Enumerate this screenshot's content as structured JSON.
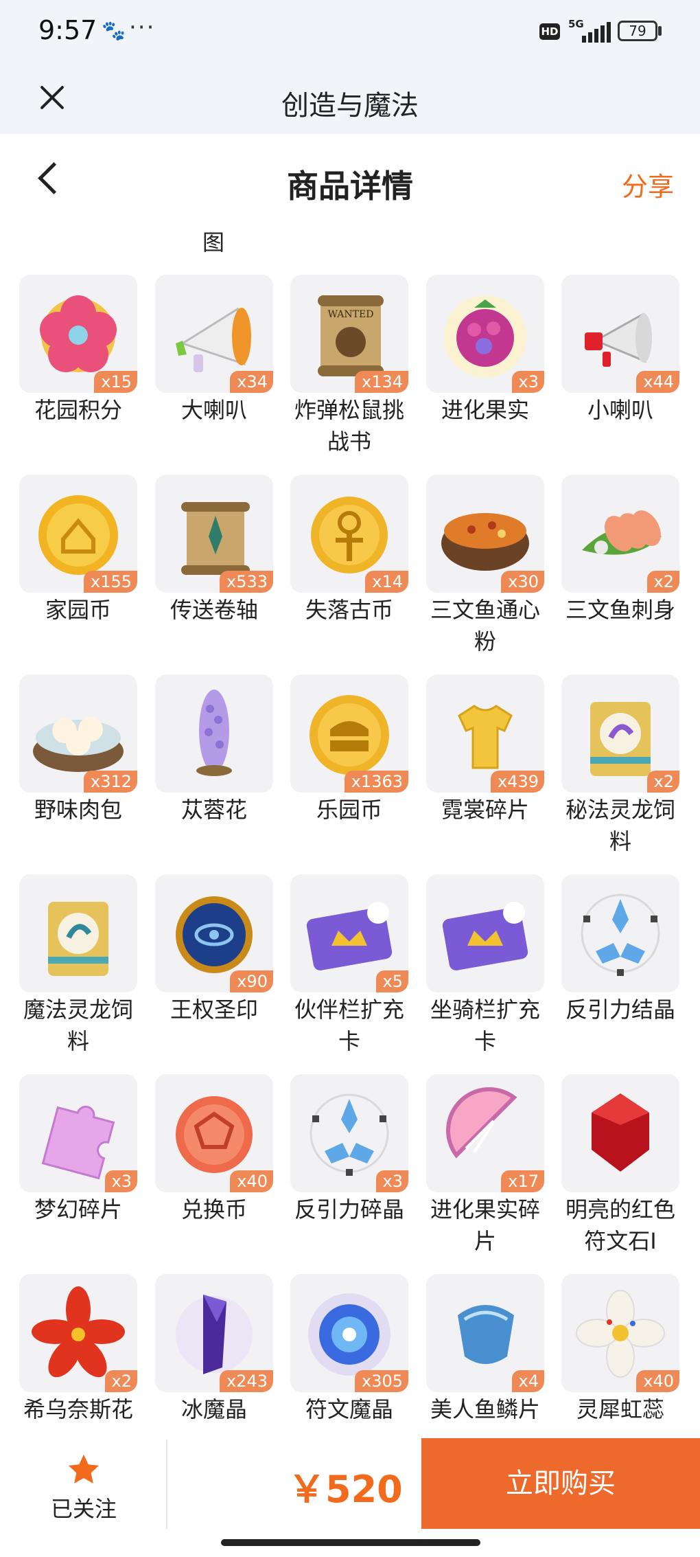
{
  "status": {
    "time": "9:57",
    "network": "5G",
    "hd": "HD",
    "battery": "79"
  },
  "window": {
    "title": "创造与魔法"
  },
  "nav": {
    "title": "商品详情",
    "share": "分享"
  },
  "section_caption": "图",
  "items": [
    {
      "name": "花园积分",
      "qty": "x15",
      "icon": "flower-token-icon"
    },
    {
      "name": "大喇叭",
      "qty": "x34",
      "icon": "megaphone-icon"
    },
    {
      "name": "炸弹松鼠挑战书",
      "qty": "x134",
      "icon": "wanted-scroll-icon"
    },
    {
      "name": "进化果实",
      "qty": "x3",
      "icon": "berry-icon"
    },
    {
      "name": "小喇叭",
      "qty": "x44",
      "icon": "small-megaphone-icon"
    },
    {
      "name": "家园币",
      "qty": "x155",
      "icon": "home-coin-icon"
    },
    {
      "name": "传送卷轴",
      "qty": "x533",
      "icon": "teleport-scroll-icon"
    },
    {
      "name": "失落古币",
      "qty": "x14",
      "icon": "ancient-coin-icon"
    },
    {
      "name": "三文鱼通心粉",
      "qty": "x30",
      "icon": "salmon-pasta-icon"
    },
    {
      "name": "三文鱼刺身",
      "qty": "x2",
      "icon": "salmon-sashimi-icon"
    },
    {
      "name": "野味肉包",
      "qty": "x312",
      "icon": "bun-steamer-icon"
    },
    {
      "name": "苁蓉花",
      "qty": "",
      "icon": "cistanche-flower-icon"
    },
    {
      "name": "乐园币",
      "qty": "x1363",
      "icon": "paradise-coin-icon"
    },
    {
      "name": "霓裳碎片",
      "qty": "x439",
      "icon": "shirt-fragment-icon"
    },
    {
      "name": "秘法灵龙饲料",
      "qty": "x2",
      "icon": "dragon-feed-bag-icon"
    },
    {
      "name": "魔法灵龙饲料",
      "qty": "",
      "icon": "magic-dragon-feed-icon"
    },
    {
      "name": "王权圣印",
      "qty": "x90",
      "icon": "royal-seal-icon"
    },
    {
      "name": "伙伴栏扩充卡",
      "qty": "x5",
      "icon": "partner-slot-card-icon"
    },
    {
      "name": "坐骑栏扩充卡",
      "qty": "",
      "icon": "mount-slot-card-icon"
    },
    {
      "name": "反引力结晶",
      "qty": "",
      "icon": "antigravity-crystal-icon"
    },
    {
      "name": "梦幻碎片",
      "qty": "x3",
      "icon": "puzzle-piece-icon"
    },
    {
      "name": "兑换币",
      "qty": "x40",
      "icon": "exchange-coin-icon"
    },
    {
      "name": "反引力碎晶",
      "qty": "x3",
      "icon": "antigravity-shard-icon"
    },
    {
      "name": "进化果实碎片",
      "qty": "x17",
      "icon": "fruit-slice-icon"
    },
    {
      "name": "明亮的红色符文石I",
      "qty": "",
      "icon": "red-rune-stone-icon"
    },
    {
      "name": "希乌奈斯花",
      "qty": "x2",
      "icon": "red-flower-icon"
    },
    {
      "name": "冰魔晶",
      "qty": "x243",
      "icon": "ice-crystal-icon"
    },
    {
      "name": "符文魔晶",
      "qty": "x305",
      "icon": "rune-orb-icon"
    },
    {
      "name": "美人鱼鳞片",
      "qty": "x4",
      "icon": "mermaid-scale-icon"
    },
    {
      "name": "灵犀虹蕊",
      "qty": "x40",
      "icon": "white-blossom-icon"
    }
  ],
  "footer": {
    "follow_label": "已关注",
    "price": "￥520",
    "buy_label": "立即购买"
  },
  "colors": {
    "accent": "#ee6a2c",
    "qty_badge": "#ef8a57",
    "title_bg": "#f1f4f8"
  }
}
